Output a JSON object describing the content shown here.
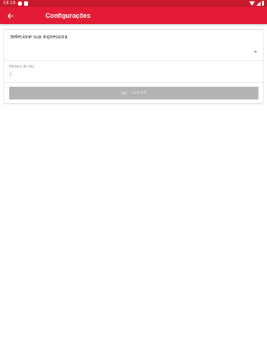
{
  "status_bar": {
    "time": "13:10",
    "icons": [
      "notification-icon",
      "sd-card-icon",
      "wifi-icon",
      "signal-icon",
      "battery-icon"
    ]
  },
  "app_bar": {
    "title": "Configurações",
    "back_icon": "arrow-left-icon",
    "background_color": "#e31b35"
  },
  "form": {
    "printer_label": "Selecione sua impressora",
    "printer_selected": "",
    "copies_label": "Número de vias",
    "copies_value": "1",
    "test_button_label": "TESTAR"
  }
}
